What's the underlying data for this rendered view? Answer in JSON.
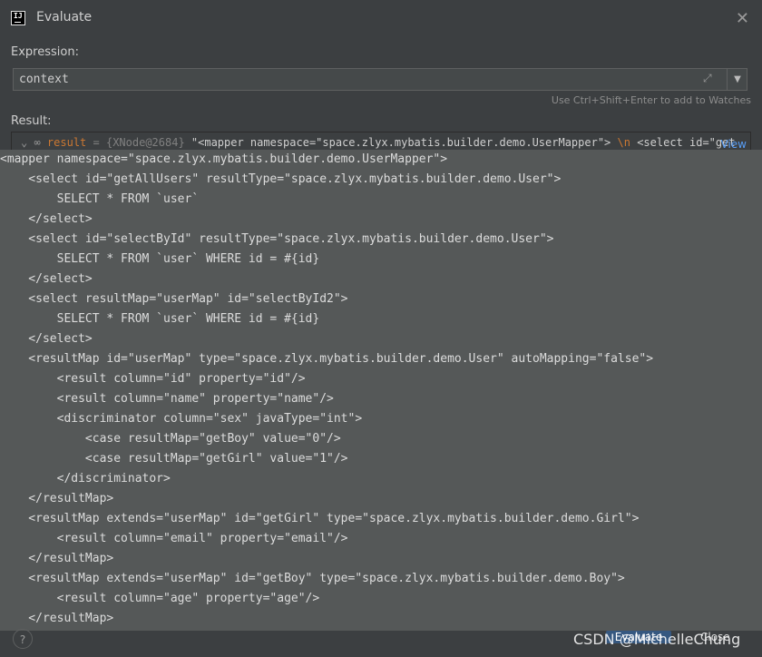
{
  "window": {
    "title": "Evaluate",
    "app_icon": "intellij-icon"
  },
  "expression": {
    "label": "Expression:",
    "value": "context",
    "hint": "Use Ctrl+Shift+Enter to add to Watches"
  },
  "result": {
    "label": "Result:",
    "var_name": "result",
    "ref": "{XNode@2684}",
    "preview": "\"<mapper namespace=\"space.zlyx.mybatis.builder.demo.UserMapper\">",
    "escape": "\\n",
    "preview_tail": "<select id=\"get",
    "view_link": "View"
  },
  "code_lines": [
    "<mapper namespace=\"space.zlyx.mybatis.builder.demo.UserMapper\">",
    "    <select id=\"getAllUsers\" resultType=\"space.zlyx.mybatis.builder.demo.User\">",
    "        SELECT * FROM `user`",
    "    </select>",
    "    <select id=\"selectById\" resultType=\"space.zlyx.mybatis.builder.demo.User\">",
    "        SELECT * FROM `user` WHERE id = #{id}",
    "    </select>",
    "    <select resultMap=\"userMap\" id=\"selectById2\">",
    "        SELECT * FROM `user` WHERE id = #{id}",
    "    </select>",
    "    <resultMap id=\"userMap\" type=\"space.zlyx.mybatis.builder.demo.User\" autoMapping=\"false\">",
    "        <result column=\"id\" property=\"id\"/>",
    "        <result column=\"name\" property=\"name\"/>",
    "        <discriminator column=\"sex\" javaType=\"int\">",
    "            <case resultMap=\"getBoy\" value=\"0\"/>",
    "            <case resultMap=\"getGirl\" value=\"1\"/>",
    "        </discriminator>",
    "    </resultMap>",
    "    <resultMap extends=\"userMap\" id=\"getGirl\" type=\"space.zlyx.mybatis.builder.demo.Girl\">",
    "        <result column=\"email\" property=\"email\"/>",
    "    </resultMap>",
    "    <resultMap extends=\"userMap\" id=\"getBoy\" type=\"space.zlyx.mybatis.builder.demo.Boy\">",
    "        <result column=\"age\" property=\"age\"/>",
    "    </resultMap>"
  ],
  "buttons": {
    "evaluate": "Evaluate",
    "close": "Close",
    "help": "?"
  },
  "watermark": "CSDN @MichelleChung",
  "colors": {
    "background": "#3c3f41",
    "popup": "#555858",
    "accent": "#365880",
    "link": "#589df6"
  }
}
